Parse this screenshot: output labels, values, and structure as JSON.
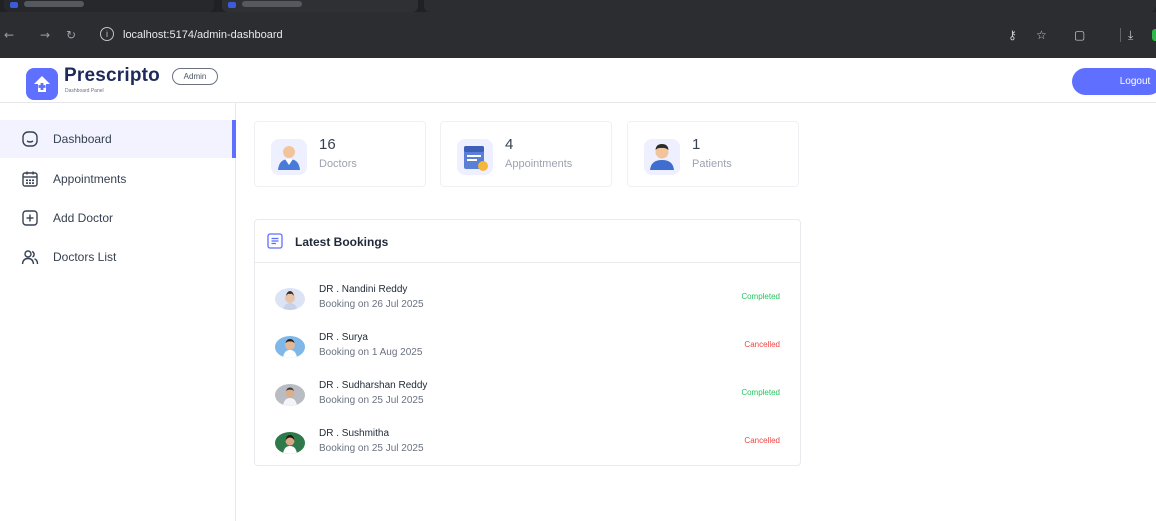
{
  "browser": {
    "url": "localhost:5174/admin-dashboard",
    "info_glyph": "i"
  },
  "header": {
    "brand": "Prescripto",
    "brand_subtitle": "Dashboard Panel",
    "role_badge": "Admin",
    "logout_label": "Logout"
  },
  "sidebar": {
    "items": [
      {
        "label": "Dashboard",
        "icon": "home-icon",
        "active": true
      },
      {
        "label": "Appointments",
        "icon": "calendar-icon",
        "active": false
      },
      {
        "label": "Add Doctor",
        "icon": "add-icon",
        "active": false
      },
      {
        "label": "Doctors List",
        "icon": "people-icon",
        "active": false
      }
    ]
  },
  "stats": [
    {
      "value": "16",
      "label": "Doctors",
      "icon": "doctor-icon"
    },
    {
      "value": "4",
      "label": "Appointments",
      "icon": "appointments-icon"
    },
    {
      "value": "1",
      "label": "Patients",
      "icon": "patients-icon"
    }
  ],
  "bookings": {
    "title": "Latest Bookings",
    "items": [
      {
        "name": "DR . Nandini Reddy",
        "date": "Booking on 26 Jul 2025",
        "status": "Completed"
      },
      {
        "name": "DR . Surya",
        "date": "Booking on 1 Aug 2025",
        "status": "Cancelled"
      },
      {
        "name": "DR . Sudharshan Reddy",
        "date": "Booking on 25 Jul 2025",
        "status": "Completed"
      },
      {
        "name": "DR . Sushmitha",
        "date": "Booking on 25 Jul 2025",
        "status": "Cancelled"
      }
    ]
  },
  "colors": {
    "primary": "#5f6fff",
    "completed": "#22c55e",
    "cancelled": "#ef4444"
  }
}
